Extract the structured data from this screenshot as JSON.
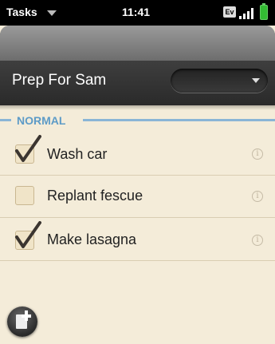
{
  "status_bar": {
    "app_name": "Tasks",
    "time": "11:41",
    "carrier": "Ev"
  },
  "list": {
    "title": "Prep For Sam",
    "dropdown_value": ""
  },
  "section": {
    "label": "NORMAL"
  },
  "tasks": [
    {
      "label": "Wash car",
      "checked": true
    },
    {
      "label": "Replant fescue",
      "checked": false
    },
    {
      "label": "Make lasagna",
      "checked": true
    }
  ],
  "icons": {
    "info": "i",
    "add": "add-task-icon"
  },
  "colors": {
    "accent": "#5d9bc7",
    "background": "#f4ecd9",
    "header": "#3e3e3e"
  }
}
